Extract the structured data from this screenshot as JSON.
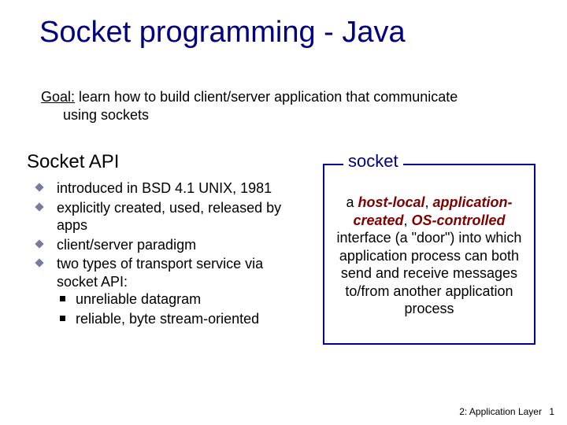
{
  "title": "Socket programming - Java",
  "goal": {
    "label": "Goal:",
    "line1": " learn how to build client/server application that communicate",
    "line2": "using sockets"
  },
  "subhead": "Socket API",
  "bullets": {
    "b1": "introduced in BSD 4.1 UNIX, 1981",
    "b2": "explicitly created, used, released by apps",
    "b3": "client/server paradigm",
    "b4": "two types of transport service via socket API:",
    "b4a": "unreliable datagram",
    "b4b": "reliable, byte stream-oriented"
  },
  "box": {
    "label": "socket",
    "t1": "a ",
    "t2": "host-local",
    "t3": ", ",
    "t4": "application-created",
    "t5": ", ",
    "t6": "OS-controlled",
    "t7": " interface (a \"door\") into which application process can both send and receive messages to/from another application process"
  },
  "footer": {
    "chapter": "2: Application Layer",
    "page": "1"
  }
}
